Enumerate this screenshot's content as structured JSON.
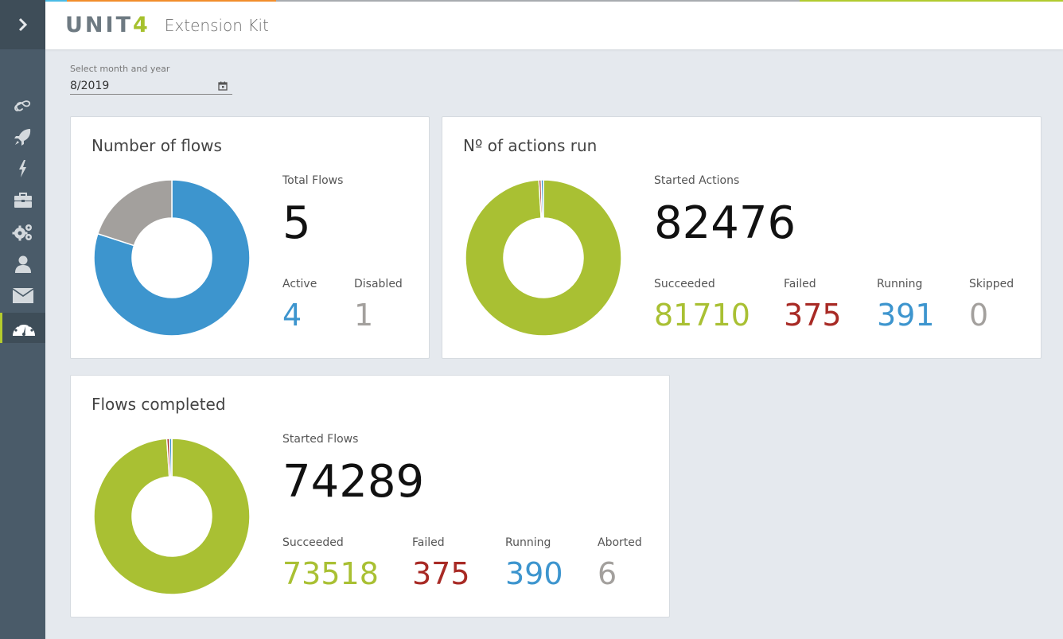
{
  "app": {
    "logo": "UNIT",
    "logo_accent": "4",
    "name": "Extension Kit"
  },
  "sidebar": {
    "toggle_icon": "chevron-right-icon",
    "items": [
      {
        "icon": "infinity-icon",
        "active": false
      },
      {
        "icon": "rocket-icon",
        "active": false
      },
      {
        "icon": "lightning-icon",
        "active": false
      },
      {
        "icon": "briefcase-icon",
        "active": false
      },
      {
        "icon": "gears-icon",
        "active": false
      },
      {
        "icon": "user-icon",
        "active": false
      },
      {
        "icon": "envelope-icon",
        "active": false
      },
      {
        "icon": "dashboard-icon",
        "active": true
      }
    ]
  },
  "filter": {
    "label": "Select month and year",
    "value": "8/2019"
  },
  "colors": {
    "blue": "#3d95ce",
    "gray": "#a3a09d",
    "green": "#a9c033",
    "red": "#a82a25",
    "stripe_cyan": "#4bbde6",
    "stripe_orange": "#f28e2c",
    "stripe_gray": "#a9adb1",
    "stripe_green": "#b3cc2f"
  },
  "cards": {
    "flows": {
      "title": "Number of flows",
      "total_label": "Total Flows",
      "total_value": "5",
      "stats": [
        {
          "label": "Active",
          "value": "4",
          "color": "#3d95ce"
        },
        {
          "label": "Disabled",
          "value": "1",
          "color": "#a3a09d"
        }
      ]
    },
    "actions": {
      "title": "Nº of actions run",
      "total_label": "Started Actions",
      "total_value": "82476",
      "stats": [
        {
          "label": "Succeeded",
          "value": "81710",
          "color": "#a9c033"
        },
        {
          "label": "Failed",
          "value": "375",
          "color": "#a82a25"
        },
        {
          "label": "Running",
          "value": "391",
          "color": "#3d95ce"
        },
        {
          "label": "Skipped",
          "value": "0",
          "color": "#a3a09d"
        }
      ]
    },
    "completed": {
      "title": "Flows completed",
      "total_label": "Started Flows",
      "total_value": "74289",
      "stats": [
        {
          "label": "Succeeded",
          "value": "73518",
          "color": "#a9c033"
        },
        {
          "label": "Failed",
          "value": "375",
          "color": "#a82a25"
        },
        {
          "label": "Running",
          "value": "390",
          "color": "#3d95ce"
        },
        {
          "label": "Aborted",
          "value": "6",
          "color": "#a3a09d"
        }
      ]
    }
  },
  "chart_data": [
    {
      "type": "pie",
      "title": "Number of flows",
      "categories": [
        "Active",
        "Disabled"
      ],
      "values": [
        4,
        1
      ],
      "colors": [
        "#3d95ce",
        "#a3a09d"
      ]
    },
    {
      "type": "pie",
      "title": "Nº of actions run",
      "categories": [
        "Succeeded",
        "Failed",
        "Running",
        "Skipped"
      ],
      "values": [
        81710,
        375,
        391,
        0
      ],
      "colors": [
        "#a9c033",
        "#a82a25",
        "#3d95ce",
        "#a3a09d"
      ]
    },
    {
      "type": "pie",
      "title": "Flows completed",
      "categories": [
        "Succeeded",
        "Failed",
        "Running",
        "Aborted"
      ],
      "values": [
        73518,
        375,
        390,
        6
      ],
      "colors": [
        "#a9c033",
        "#a82a25",
        "#3d95ce",
        "#a3a09d"
      ]
    }
  ]
}
